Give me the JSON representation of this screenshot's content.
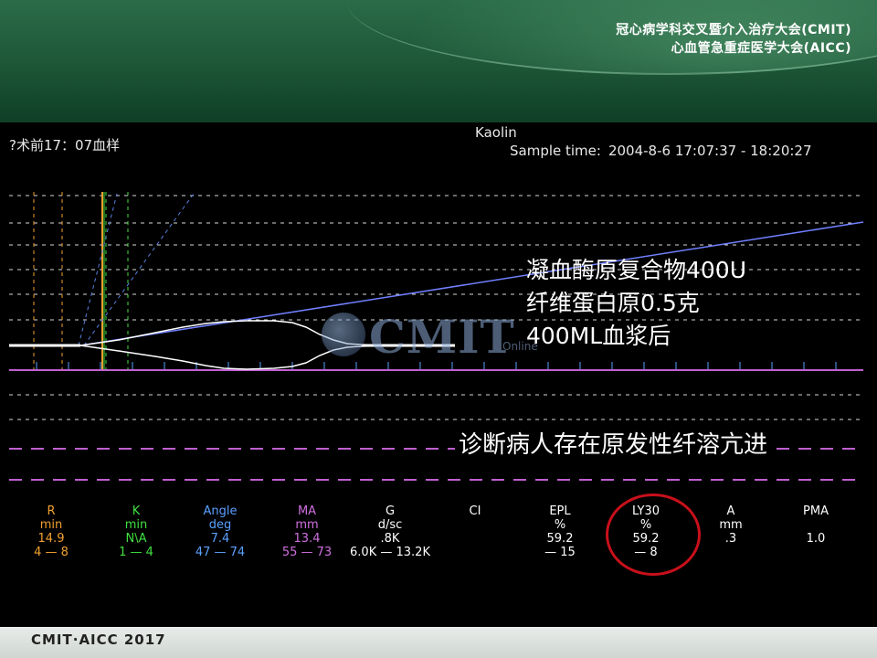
{
  "header": {
    "conference_line1": "冠心病学科交叉暨介入治疗大会(CMIT)",
    "conference_line2": "心血管急重症医学大会(AICC)"
  },
  "panel": {
    "activator": "Kaolin",
    "sample_label": "?术前17：07血样",
    "sample_time_label": "Sample time:",
    "sample_time_value": "2004-8-6 17:07:37 - 18:20:27"
  },
  "annotation": {
    "line1": "凝血酶原复合物400U",
    "line2": "纤维蛋白原0.5克",
    "line3": "400ML血浆后",
    "diagnosis": "诊断病人存在原发性纤溶亢进"
  },
  "watermark": {
    "text": "CMIT",
    "sub": "Online"
  },
  "parameters": [
    {
      "name": "R",
      "unit": "min",
      "value": "14.9",
      "range": "4 — 8",
      "color": "#f0a030"
    },
    {
      "name": "K",
      "unit": "min",
      "value": "N\\A",
      "range": "1 — 4",
      "color": "#40e040"
    },
    {
      "name": "Angle",
      "unit": "deg",
      "value": "7.4",
      "range": "47 — 74",
      "color": "#5aa0ff"
    },
    {
      "name": "MA",
      "unit": "mm",
      "value": "13.4",
      "range": "55 — 73",
      "color": "#d070e0"
    },
    {
      "name": "G",
      "unit": "d/sc",
      "value": ".8K",
      "range": "6.0K — 13.2K",
      "color": "#ffffff"
    },
    {
      "name": "CI",
      "unit": "",
      "value": "",
      "range": "",
      "color": "#ffffff"
    },
    {
      "name": "EPL",
      "unit": "%",
      "value": "59.2",
      "range": "— 15",
      "color": "#ffffff"
    },
    {
      "name": "LY30",
      "unit": "%",
      "value": "59.2",
      "range": "— 8",
      "color": "#ffffff"
    },
    {
      "name": "A",
      "unit": "mm",
      "value": ".3",
      "range": "",
      "color": "#ffffff"
    },
    {
      "name": "PMA",
      "unit": "",
      "value": "1.0",
      "range": "",
      "color": "#ffffff"
    }
  ],
  "footer": {
    "logo": "CMIT·AICC 2017"
  },
  "colors": {
    "header_green": "#1f5a3a",
    "trace_white": "#ffffff",
    "trace_blue": "#7080ff",
    "baseline_magenta": "#c060d0",
    "highlight_circle": "#c8101a"
  }
}
